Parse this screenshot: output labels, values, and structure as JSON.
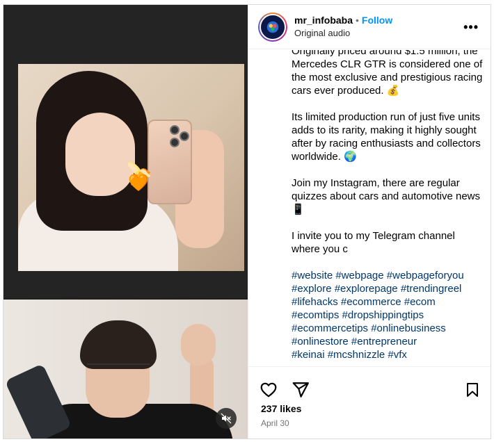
{
  "post": {
    "username": "mr_infobaba",
    "separator": "•",
    "follow_label": "Follow",
    "audio_label": "Original audio",
    "more_label": "•••"
  },
  "caption": {
    "paragraph_1": "Originally priced around $1.5 million, the Mercedes CLR GTR is considered one of the most exclusive and prestigious racing cars ever produced. 💰",
    "paragraph_2": "Its limited production run of just five units adds to its rarity, making it highly sought after by racing enthusiasts and collectors worldwide. 🌍",
    "paragraph_3": "Join my Instagram, there are regular quizzes about cars and automotive news 📱",
    "paragraph_4": "I invite you to my Telegram channel where you c",
    "hashtags": [
      "#website",
      "#webpage",
      "#webpageforyou",
      "#explore",
      "#explorepage",
      "#trendingreel",
      "#lifehacks",
      "#ecommerce",
      "#ecom",
      "#ecomtips",
      "#dropshippingtips",
      "#ecommercetips",
      "#onlinebusiness",
      "#onlinestore",
      "#entrepreneur",
      "#keinai",
      "#mcshnizzle",
      "#vfx"
    ]
  },
  "engagement": {
    "likes": "237 likes",
    "date": "April 30"
  },
  "icons": {
    "like": "heart-icon",
    "share": "send-icon",
    "save": "bookmark-icon",
    "mute": "speaker-muted-icon",
    "more": "more-options-icon"
  },
  "colors": {
    "follow": "#0095f6",
    "hashtag": "#00376b",
    "muted_text": "#737373"
  }
}
